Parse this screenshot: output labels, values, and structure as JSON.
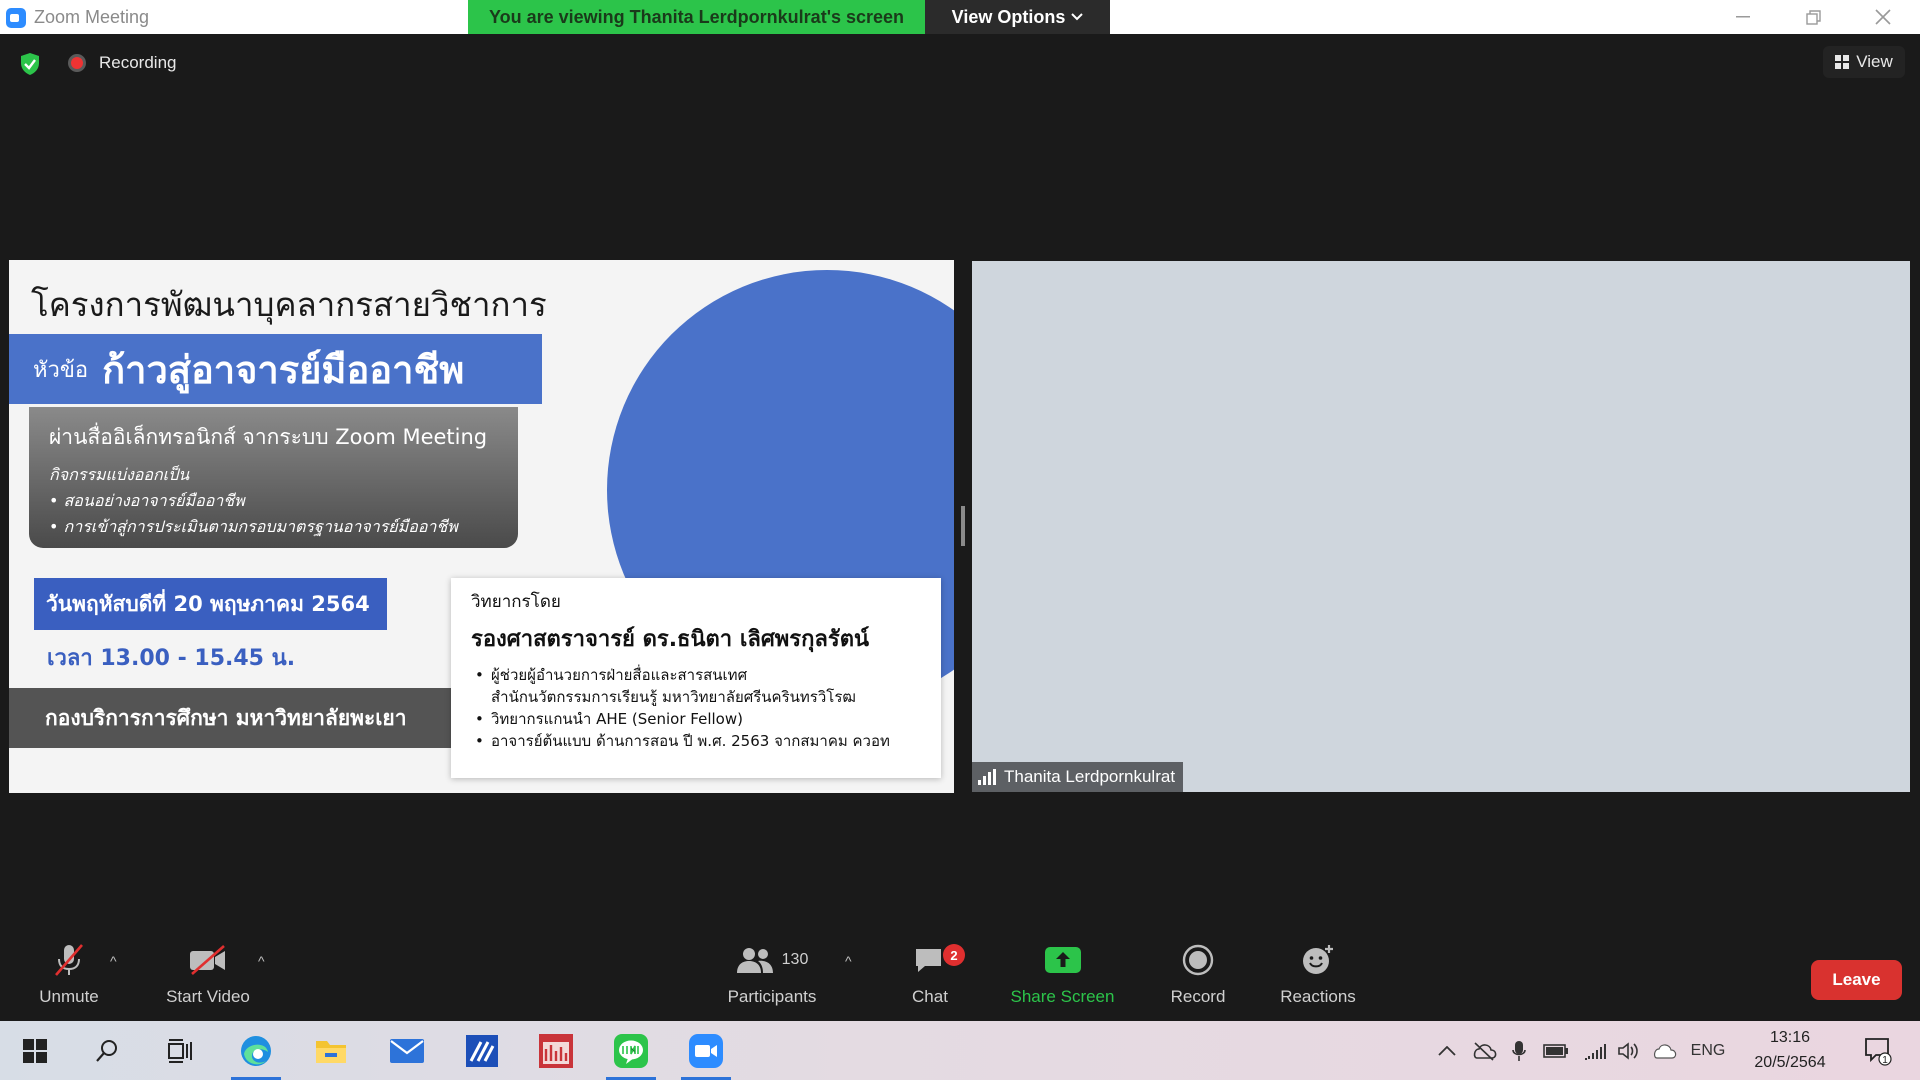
{
  "titlebar": {
    "app_title": "Zoom Meeting",
    "viewing_banner": "You are viewing Thanita Lerdpornkulrat's screen",
    "view_options_label": "View Options"
  },
  "meeting_top": {
    "recording_label": "Recording",
    "view_label": "View"
  },
  "slide": {
    "title": "โครงการพัฒนาบุคลากรสายวิชาการ",
    "topic_prefix": "หัวข้อ",
    "topic_main": "ก้าวสู่อาจารย์มืออาชีพ",
    "desc_head": "ผ่านสื่ออิเล็กทรอนิกส์ จากระบบ Zoom Meeting",
    "desc_lines": [
      "กิจกรรมแบ่งออกเป็น",
      "• สอนอย่างอาจารย์มืออาชีพ",
      "• การเข้าสู่การประเมินตามกรอบมาตรฐานอาจารย์มืออาชีพ"
    ],
    "date": "วันพฤหัสบดีที่ 20 พฤษภาคม 2564",
    "time": "เวลา 13.00 - 15.45 น.",
    "organizer": "กองบริการการศึกษา มหาวิทยาลัยพะเยา",
    "speaker_label": "วิทยากรโดย",
    "speaker_name": "รองศาสตราจารย์ ดร.ธนิตา เลิศพรกุลรัตน์",
    "speaker_bullets": [
      "ผู้ช่วยผู้อำนวยการฝ่ายสื่อและสารสนเทศ",
      "สำนักนวัตกรรมการเรียนรู้ มหาวิทยาลัยศรีนครินทรวิโรฒ",
      "วิทยากรแกนนำ AHE (Senior Fellow)",
      "อาจารย์ต้นแบบ ด้านการสอน ปี พ.ศ. 2563 จากสมาคม ควอท"
    ]
  },
  "video": {
    "participant_name": "Thanita Lerdpornkulrat"
  },
  "toolbar": {
    "unmute": "Unmute",
    "start_video": "Start Video",
    "participants_count": "130",
    "participants": "Participants",
    "chat": "Chat",
    "chat_badge": "2",
    "share_screen": "Share Screen",
    "record": "Record",
    "reactions": "Reactions",
    "leave": "Leave"
  },
  "taskbar": {
    "language": "ENG",
    "time": "13:16",
    "date": "20/5/2564",
    "notification_count": "1"
  },
  "colors": {
    "share_green": "#2cc44a",
    "leave_red": "#d9322f",
    "slide_blue": "#4a72c9"
  }
}
